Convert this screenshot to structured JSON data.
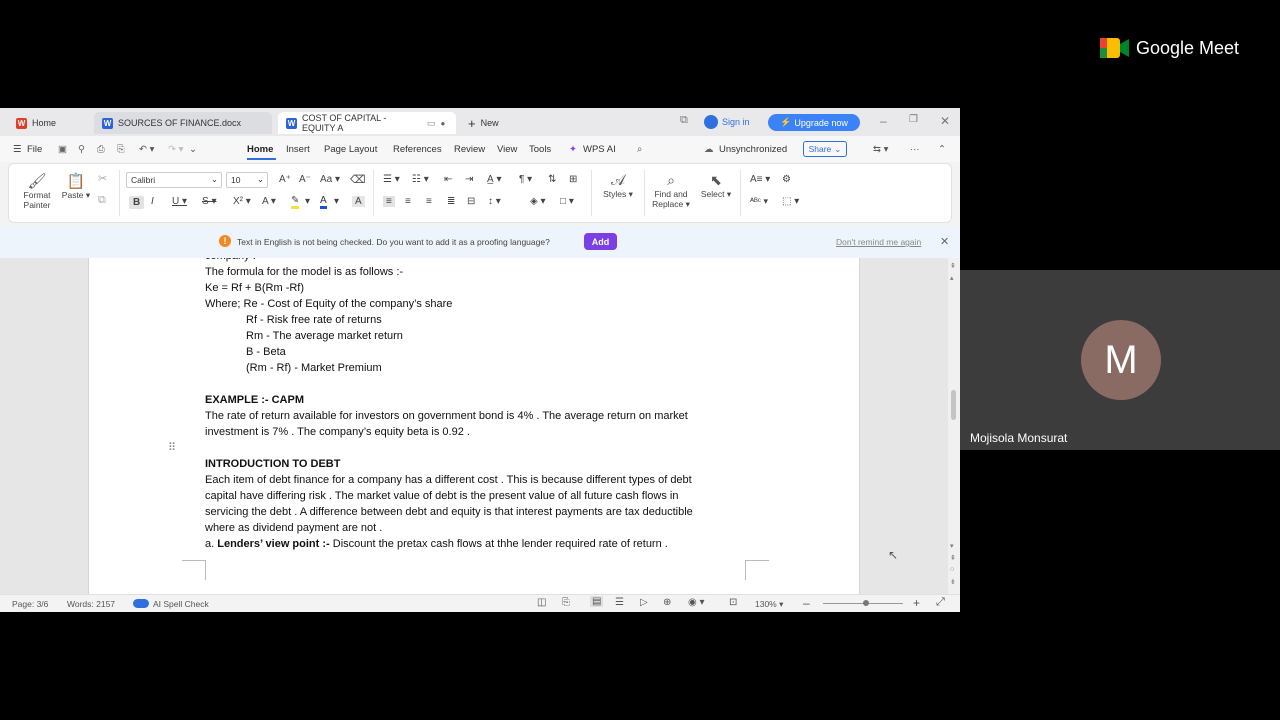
{
  "tabs": [
    {
      "label": "Home"
    },
    {
      "label": "SOURCES OF FINANCE.docx"
    },
    {
      "label": "COST OF CAPITAL - EQUITY A"
    },
    {
      "label": "New"
    }
  ],
  "titlebar": {
    "sign_in": "Sign in",
    "upgrade": "Upgrade now"
  },
  "menu": {
    "file": "File",
    "items": [
      "Home",
      "Insert",
      "Page Layout",
      "References",
      "Review",
      "View",
      "Tools",
      "WPS AI"
    ],
    "unsynchronized": "Unsynchronized",
    "share": "Share"
  },
  "ribbon": {
    "format_painter_1": "Format",
    "format_painter_2": "Painter",
    "paste": "Paste",
    "font": "Calibri",
    "size": "10",
    "styles": "Styles",
    "find_1": "Find and",
    "find_2": "Replace",
    "select": "Select"
  },
  "notice": {
    "text": "Text in English is not being checked. Do you want to add it as a proofing language?",
    "add": "Add",
    "dont_remind": "Don't remind me again"
  },
  "document": {
    "lines": [
      {
        "text": "company .",
        "style": "normal"
      },
      {
        "text": "The formula for the model is as follows :-",
        "style": "normal"
      },
      {
        "text": "Ke = Rf + B(Rm -Rf)",
        "style": "normal"
      },
      {
        "text": "Where; Re - Cost of Equity of the company’s share",
        "style": "normal"
      },
      {
        "text": "Rf - Risk free rate of returns",
        "style": "indent"
      },
      {
        "text": "Rm - The average market return",
        "style": "indent"
      },
      {
        "text": "B - Beta",
        "style": "indent"
      },
      {
        "text": "(Rm - Rf) - Market Premium",
        "style": "indent"
      },
      {
        "text": "EXAMPLE :- CAPM",
        "style": "bold"
      },
      {
        "text": "The rate of return available for investors on government bond is 4% . The average return on market",
        "style": "normal"
      },
      {
        "text": "investment is 7% . The company’s equity beta is 0.92 .",
        "style": "normal"
      },
      {
        "text": "INTRODUCTION TO DEBT",
        "style": "bold"
      },
      {
        "text": "Each item of debt finance for a company has a different cost . This is because different types of debt",
        "style": "normal"
      },
      {
        "text": "capital have differing risk . The market value of debt is the present value of all future cash flows in",
        "style": "normal"
      },
      {
        "text": "servicing the debt . A difference between debt and equity is that interest payments are tax deductible",
        "style": "normal"
      },
      {
        "text": "where as dividend payment are not .",
        "style": "normal"
      }
    ],
    "last_prefix": "a. ",
    "last_bold": "Lenders’ view point :-",
    "last_rest": " Discount the pretax cash flows at thhe lender required rate of return ."
  },
  "status": {
    "page": "Page: 3/6",
    "words": "Words: 2157",
    "spell": "AI Spell Check",
    "zoom": "130%"
  },
  "meet": {
    "brand": "Google Meet",
    "initial": "M",
    "participant": "Mojisola Monsurat"
  }
}
